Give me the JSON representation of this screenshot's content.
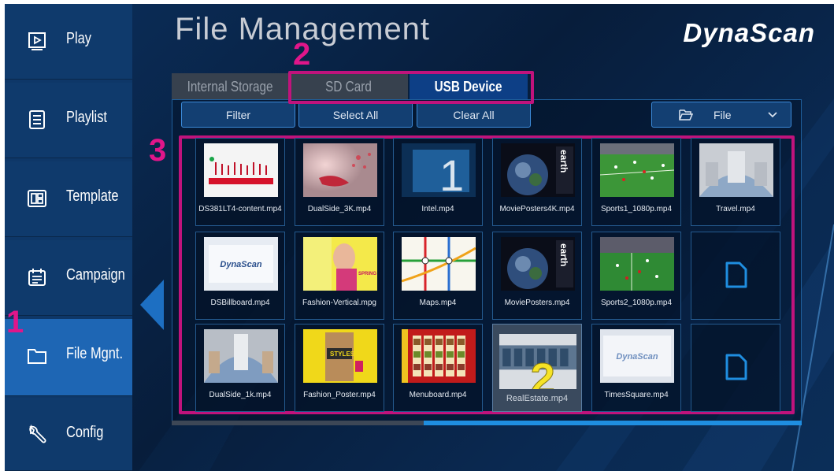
{
  "header": {
    "title": "File Management",
    "brand": "DynaScan"
  },
  "sidebar": {
    "items": [
      {
        "label": "Play",
        "icon": "play-icon",
        "active": false
      },
      {
        "label": "Playlist",
        "icon": "playlist-icon",
        "active": false
      },
      {
        "label": "Template",
        "icon": "template-icon",
        "active": false
      },
      {
        "label": "Campaign",
        "icon": "campaign-icon",
        "active": false
      },
      {
        "label": "File Mgnt.",
        "icon": "folder-icon",
        "active": true
      },
      {
        "label": "Config",
        "icon": "wrench-icon",
        "active": false
      }
    ]
  },
  "tabs": [
    {
      "label": "Internal Storage",
      "active": false
    },
    {
      "label": "SD Card",
      "active": false
    },
    {
      "label": "USB Device",
      "active": true
    }
  ],
  "toolbar": {
    "filter_label": "Filter",
    "select_all_label": "Select All",
    "clear_all_label": "Clear All",
    "type_dropdown_value": "File"
  },
  "files": [
    {
      "name": "DS381LT4-content.mp4",
      "thumb": "ds381"
    },
    {
      "name": "DualSide_3K.mp4",
      "thumb": "face"
    },
    {
      "name": "Intel.mp4",
      "thumb": "intel"
    },
    {
      "name": "MoviePosters4K.mp4",
      "thumb": "earth"
    },
    {
      "name": "Sports1_1080p.mp4",
      "thumb": "soccer"
    },
    {
      "name": "Travel.mp4",
      "thumb": "travel"
    },
    {
      "name": "DSBillboard.mp4",
      "thumb": "dynascan"
    },
    {
      "name": "Fashion-Vertical.mpg",
      "thumb": "fashion"
    },
    {
      "name": "Maps.mp4",
      "thumb": "map"
    },
    {
      "name": "MoviePosters.mp4",
      "thumb": "earth"
    },
    {
      "name": "Sports2_1080p.mp4",
      "thumb": "soccer2"
    },
    {
      "name": "",
      "thumb": "doc"
    },
    {
      "name": "DualSide_1k.mp4",
      "thumb": "travel2"
    },
    {
      "name": "Fashion_Poster.mp4",
      "thumb": "poster"
    },
    {
      "name": "Menuboard.mp4",
      "thumb": "menu"
    },
    {
      "name": "RealEstate.mp4",
      "thumb": "realestate",
      "selected": true
    },
    {
      "name": "TimesSquare.mp4",
      "thumb": "dynascan2"
    },
    {
      "name": "",
      "thumb": "doc"
    }
  ],
  "thumb_text": {
    "intel_digit": "1",
    "earth_text": "earth",
    "realestate_digit": "2",
    "dynascan_logo": "DynaScan",
    "fashion_text": "SPRING SUMMER",
    "poster_text": "STYLES"
  },
  "annotations": {
    "label_1": "1",
    "label_2": "2",
    "label_3": "3",
    "color": "#e0168a"
  },
  "colors": {
    "accent": "#1e66b4",
    "active_tab": "#0d3f86",
    "annotation": "#c0137c"
  }
}
